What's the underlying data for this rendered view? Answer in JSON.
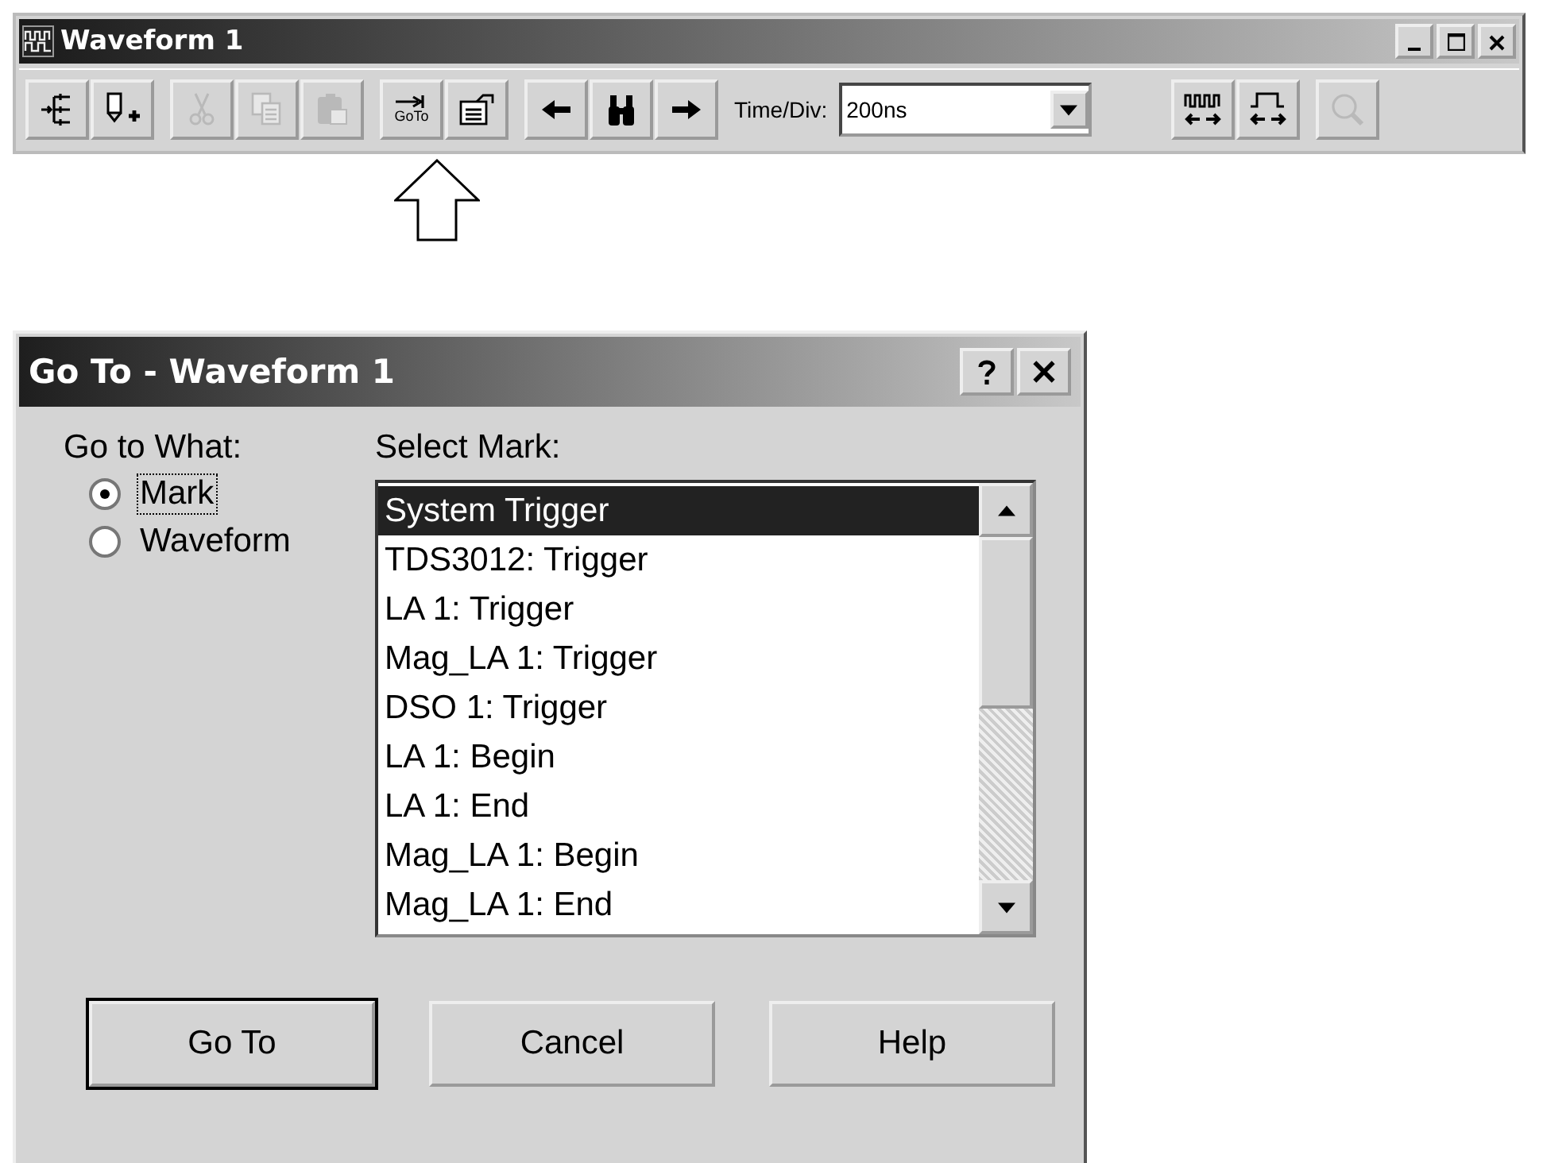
{
  "window": {
    "title": "Waveform 1"
  },
  "toolbar": {
    "groups": [
      [
        {
          "kind": "insert",
          "disabled": false
        },
        {
          "kind": "add",
          "disabled": false
        }
      ],
      [
        {
          "kind": "cut",
          "disabled": true
        },
        {
          "kind": "copy",
          "disabled": true
        },
        {
          "kind": "paste",
          "disabled": true
        }
      ],
      [
        {
          "kind": "goto",
          "label": "GoTo",
          "disabled": false
        },
        {
          "kind": "properties",
          "disabled": false
        }
      ],
      [
        {
          "kind": "prev",
          "disabled": false
        },
        {
          "kind": "find",
          "disabled": false
        },
        {
          "kind": "next",
          "disabled": false
        }
      ]
    ],
    "time_div": {
      "label": "Time/Div:",
      "value": "200ns"
    },
    "groups_after": [
      [
        {
          "kind": "wave_fine",
          "disabled": false
        },
        {
          "kind": "wave_coarse",
          "disabled": false
        }
      ],
      [
        {
          "kind": "zoom",
          "disabled": true
        }
      ]
    ]
  },
  "dialog": {
    "title": "Go To - Waveform 1",
    "go_to_what": {
      "label": "Go to What:",
      "options": [
        {
          "label": "Mark",
          "selected": true,
          "focused": true
        },
        {
          "label": "Waveform",
          "selected": false,
          "focused": false
        }
      ]
    },
    "select_mark": {
      "label": "Select Mark:",
      "items": [
        {
          "label": "System Trigger",
          "selected": true
        },
        {
          "label": "TDS3012: Trigger",
          "selected": false
        },
        {
          "label": "LA 1: Trigger",
          "selected": false
        },
        {
          "label": "Mag_LA 1: Trigger",
          "selected": false
        },
        {
          "label": "DSO 1: Trigger",
          "selected": false
        },
        {
          "label": "LA 1: Begin",
          "selected": false
        },
        {
          "label": "LA 1: End",
          "selected": false
        },
        {
          "label": "Mag_LA 1: Begin",
          "selected": false
        },
        {
          "label": "Mag_LA 1: End",
          "selected": false
        }
      ]
    },
    "buttons": [
      {
        "label": "Go To",
        "default": true
      },
      {
        "label": "Cancel",
        "default": false
      },
      {
        "label": "Help",
        "default": false
      }
    ]
  }
}
